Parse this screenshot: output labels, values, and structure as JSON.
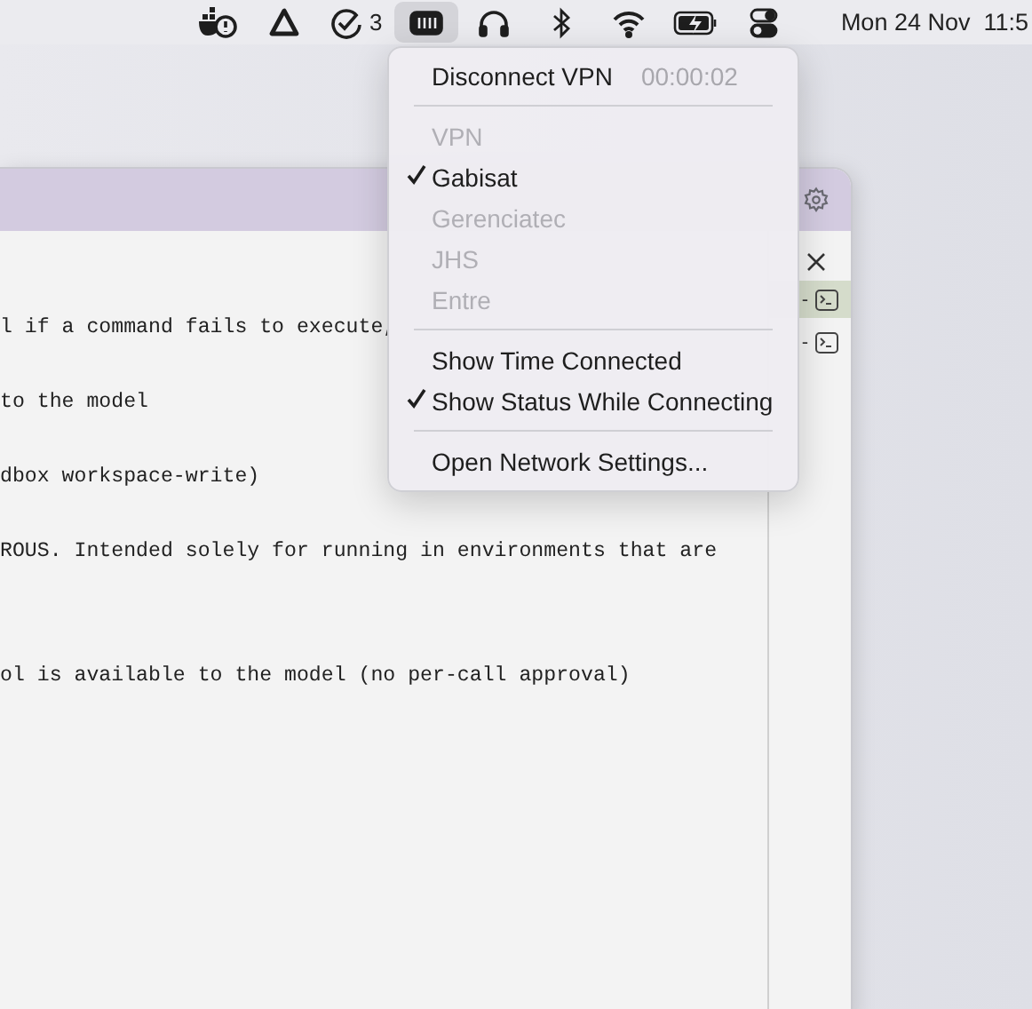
{
  "menu_bar": {
    "items": [
      {
        "kind": "docker-alert"
      },
      {
        "kind": "triangle"
      },
      {
        "kind": "check",
        "badge": "3"
      },
      {
        "kind": "vpn",
        "selected": true
      },
      {
        "kind": "headphones"
      },
      {
        "kind": "bluetooth"
      },
      {
        "kind": "wifi"
      },
      {
        "kind": "battery"
      },
      {
        "kind": "toggles"
      }
    ],
    "clock": "Mon 24 Nov  11:5"
  },
  "window": {
    "lines": [
      "l if a command fails to execute,",
      "to the model",
      "dbox workspace-write)",
      "ROUS. Intended solely for running in environments that are",
      "ol is available to the model (no per-call approval)"
    ],
    "side_rows": [
      {
        "label": "-",
        "selected": true
      },
      {
        "label": "-",
        "selected": false
      }
    ]
  },
  "vpn_menu": {
    "items": [
      {
        "kind": "action",
        "label": "Disconnect VPN",
        "detail": "00:00:02"
      },
      {
        "kind": "separator"
      },
      {
        "kind": "header",
        "label": "VPN"
      },
      {
        "kind": "network",
        "label": "Gabisat",
        "checked": true,
        "disabled": false
      },
      {
        "kind": "network",
        "label": "Gerenciatec",
        "checked": false,
        "disabled": true
      },
      {
        "kind": "network",
        "label": "JHS",
        "checked": false,
        "disabled": true
      },
      {
        "kind": "network",
        "label": "Entre",
        "checked": false,
        "disabled": true
      },
      {
        "kind": "separator"
      },
      {
        "kind": "option",
        "label": "Show Time Connected",
        "checked": false
      },
      {
        "kind": "option",
        "label": "Show Status While Connecting",
        "checked": true
      },
      {
        "kind": "separator"
      },
      {
        "kind": "action",
        "label": "Open Network Settings..."
      }
    ]
  }
}
